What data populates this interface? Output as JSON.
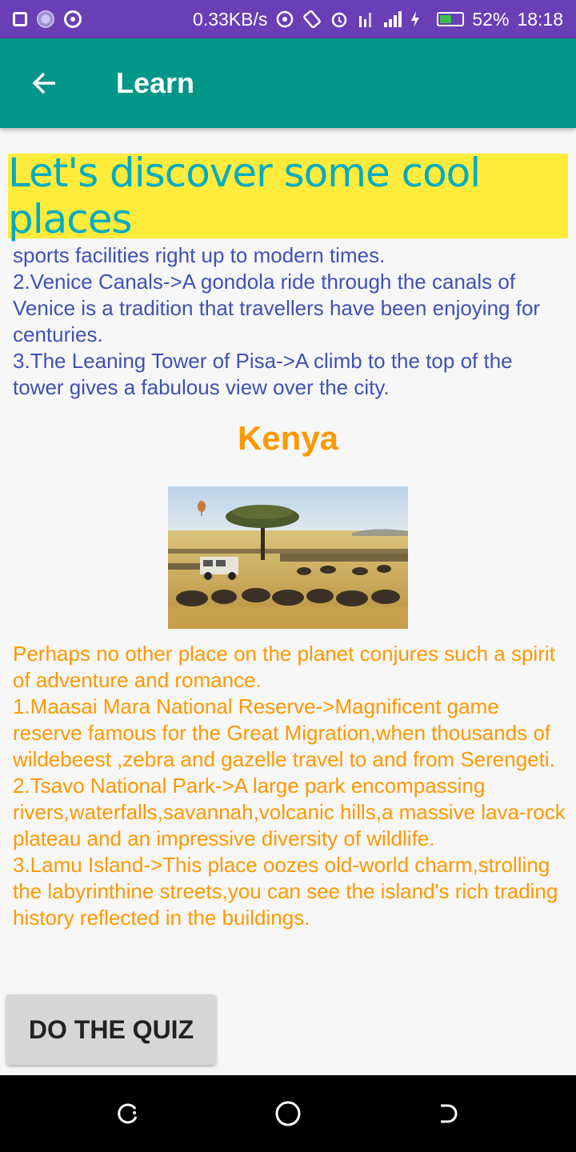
{
  "status_bar": {
    "net_speed": "0.33KB/s",
    "battery_percent": "52%",
    "battery_level": 0.52,
    "time": "18:18",
    "icons": [
      "gallery-icon",
      "flower-icon",
      "record-icon",
      "hotspot-icon",
      "rotate-icon",
      "alarm-icon",
      "data-icon",
      "signal-icon",
      "charging-icon",
      "battery-icon"
    ]
  },
  "app_bar": {
    "title": "Learn",
    "color": "#009688"
  },
  "banner": {
    "text": "Let's discover some cool places",
    "bg": "#ffeb3b",
    "color": "#00acc1"
  },
  "italy_section": {
    "lines": [
      "sports facilities right up to modern times.",
      "2.Venice Canals->A gondola ride through the canals of Venice is a tradition that travellers have been enjoying for centuries.",
      "3.The Leaning Tower of Pisa->A climb to the top of the tower gives a fabulous view over the city."
    ],
    "color": "#3f51b5"
  },
  "kenya_section": {
    "heading": "Kenya",
    "image": "kenya-safari-image",
    "paragraphs": [
      "Perhaps no other place on the planet conjures such a spirit of adventure and romance.",
      "1.Maasai Mara National Reserve->Magnificent game reserve famous for the Great Migration,when thousands of wildebeest ,zebra and gazelle travel to and from Serengeti.",
      "2.Tsavo National Park->A large park encompassing rivers,waterfalls,savannah,volcanic hills,a massive lava-rock plateau and an impressive diversity of wildlife.",
      "3.Lamu Island->This place oozes old-world charm,strolling the labyrinthine streets,you can see the island's rich trading history reflected in the buildings."
    ],
    "color": "#ff9800"
  },
  "quiz_button": {
    "label": "DO THE QUIZ"
  },
  "nav_bar": {
    "buttons": [
      "back-icon",
      "home-icon",
      "recents-icon"
    ]
  }
}
